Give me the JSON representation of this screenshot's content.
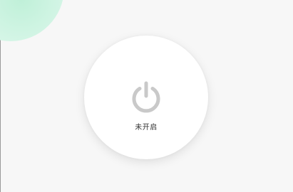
{
  "power": {
    "status_label": "未开启",
    "icon": "power-icon",
    "state": "off"
  },
  "colors": {
    "background": "#f7f7f7",
    "card": "#ffffff",
    "icon": "#c9c9c9",
    "text": "#333333",
    "accent": "#bff0d8"
  }
}
